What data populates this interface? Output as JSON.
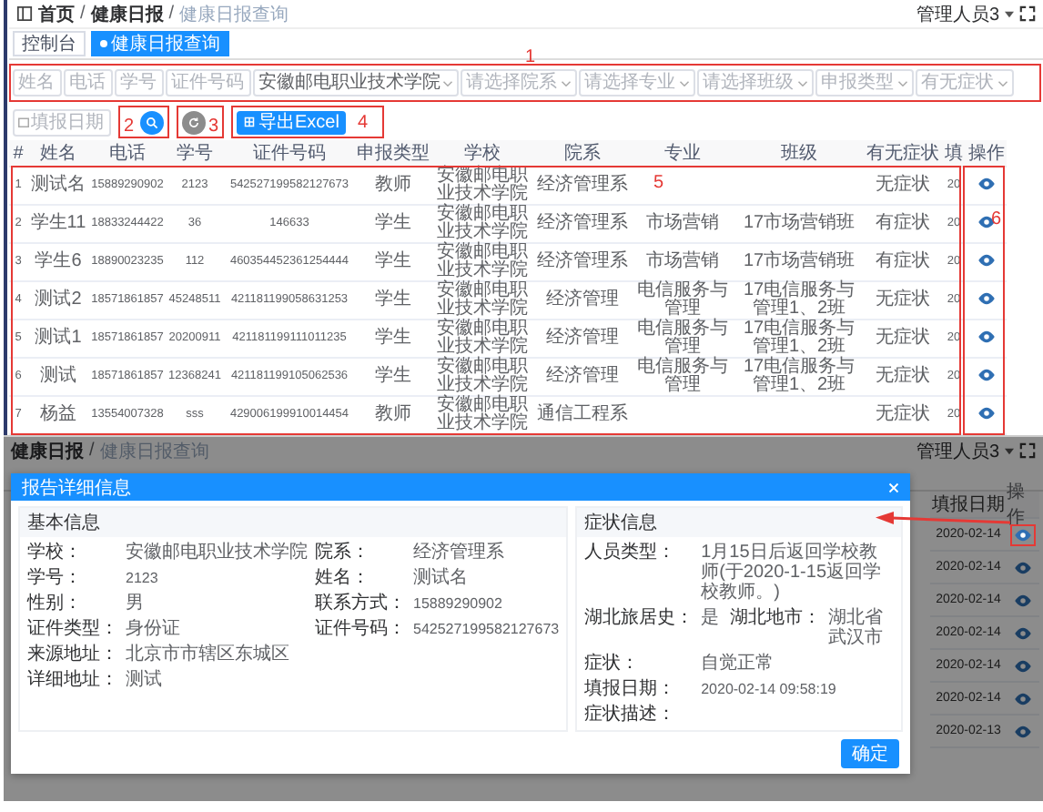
{
  "header": {
    "breadcrumb": [
      "首页",
      "健康日报",
      "健康日报查询"
    ],
    "separator": "/",
    "user": "管理人员3"
  },
  "tags": [
    {
      "label": "控制台",
      "selected": false
    },
    {
      "label": "健康日报查询",
      "selected": true
    }
  ],
  "filters": [
    {
      "kind": "input",
      "placeholder": "姓名"
    },
    {
      "kind": "input",
      "placeholder": "电话"
    },
    {
      "kind": "input",
      "placeholder": "学号"
    },
    {
      "kind": "input",
      "placeholder": "证件号码"
    },
    {
      "kind": "select",
      "value": "安徽邮电职业技术学院"
    },
    {
      "kind": "select",
      "placeholder": "请选择院系"
    },
    {
      "kind": "select",
      "placeholder": "请选择专业"
    },
    {
      "kind": "select",
      "placeholder": "请选择班级"
    },
    {
      "kind": "select",
      "placeholder": "申报类型"
    },
    {
      "kind": "select",
      "placeholder": "有无症状"
    }
  ],
  "date_filter": {
    "placeholder": "填报日期"
  },
  "export_button": "导出Excel",
  "annotations": [
    "1",
    "2",
    "3",
    "4",
    "5",
    "6"
  ],
  "table": {
    "columns": [
      "#",
      "姓名",
      "电话",
      "学号",
      "证件号码",
      "申报类型",
      "学校",
      "院系",
      "专业",
      "班级",
      "有无症状",
      "填",
      "操作"
    ],
    "rows": [
      {
        "index": "1",
        "name": "测试名",
        "phone": "15889290902",
        "student_no": "2123",
        "id_no": "542527199582127673",
        "type": "教师",
        "school": "安徽邮电职业技术学院",
        "department": "经济管理系",
        "symptom": "无症状",
        "date": "20"
      },
      {
        "index": "2",
        "name": "学生11",
        "phone": "18833244422",
        "student_no": "36",
        "id_no": "146633",
        "type": "学生",
        "school": "安徽邮电职业技术学院",
        "department": "经济管理系",
        "major": "市场营销",
        "class": "17市场营销班",
        "symptom": "有症状",
        "date": "20"
      },
      {
        "index": "3",
        "name": "学生6",
        "phone": "18890023235",
        "student_no": "112",
        "id_no": "460354452361254444",
        "type": "学生",
        "school": "安徽邮电职业技术学院",
        "department": "经济管理系",
        "major": "市场营销",
        "class": "17市场营销班",
        "symptom": "有症状",
        "date": "20"
      },
      {
        "index": "4",
        "name": "测试2",
        "phone": "18571861857",
        "student_no": "45248511",
        "id_no": "421181199058631253",
        "type": "学生",
        "school": "安徽邮电职业技术学院",
        "department": "经济管理",
        "major": "电信服务与管理",
        "class": "17电信服务与管理1、2班",
        "symptom": "无症状",
        "date": "20"
      },
      {
        "index": "5",
        "name": "测试1",
        "phone": "18571861857",
        "student_no": "20200911",
        "id_no": "421181199111011235",
        "type": "学生",
        "school": "安徽邮电职业技术学院",
        "department": "经济管理",
        "major": "电信服务与管理",
        "class": "17电信服务与管理1、2班",
        "symptom": "无症状",
        "date": "20"
      },
      {
        "index": "6",
        "name": "测试",
        "phone": "18571861857",
        "student_no": "12368241",
        "id_no": "421181199105062536",
        "type": "学生",
        "school": "安徽邮电职业技术学院",
        "department": "经济管理",
        "major": "电信服务与管理",
        "class": "17电信服务与管理1、2班",
        "symptom": "无症状",
        "date": "20"
      },
      {
        "index": "7",
        "name": "杨益",
        "phone": "13554007328",
        "student_no": "sss",
        "id_no": "429006199910014454",
        "type": "教师",
        "school": "安徽邮电职业技术学院",
        "department": "通信工程系",
        "symptom": "无症状",
        "date": "20"
      }
    ]
  },
  "second_screen": {
    "breadcrumb": [
      "健康日报",
      "健康日报查询"
    ],
    "separator": "/",
    "user": "管理人员3",
    "table": {
      "columns": [
        "填报日期",
        "操作"
      ],
      "rows": [
        {
          "date": "2020-02-14",
          "annotated": true
        },
        {
          "date": "2020-02-14",
          "annotated": false
        },
        {
          "date": "2020-02-14",
          "annotated": false
        },
        {
          "date": "2020-02-14",
          "annotated": false
        },
        {
          "date": "2020-02-14",
          "annotated": false
        },
        {
          "date": "2020-02-14",
          "annotated": false
        },
        {
          "date": "2020-02-13",
          "annotated": false
        }
      ]
    },
    "modal": {
      "title": "报告详细信息",
      "confirm": "确定",
      "cards": [
        {
          "title": "基本信息",
          "rows": [
            [
              {
                "kind": "text",
                "label": "学校：",
                "value": "安徽邮电职业技术学院"
              },
              {
                "kind": "text",
                "label": "院系：",
                "value": "经济管理系"
              }
            ],
            [
              {
                "kind": "number",
                "label": "学号：",
                "value": "2123"
              },
              {
                "kind": "text",
                "label": "姓名：",
                "value": "测试名"
              }
            ],
            [
              {
                "kind": "text",
                "label": "性别：",
                "value": "男"
              },
              {
                "kind": "number",
                "label": "联系方式：",
                "value": "15889290902"
              }
            ],
            [
              {
                "kind": "text",
                "label": "证件类型：",
                "value": "身份证"
              },
              {
                "kind": "number",
                "label": "证件号码：",
                "value": "542527199582127673"
              }
            ],
            [
              {
                "kind": "text",
                "label": "来源地址：",
                "value": "北京市市辖区东城区"
              }
            ],
            [
              {
                "kind": "text",
                "label": "详细地址：",
                "value": "测试"
              }
            ]
          ]
        },
        {
          "title": "症状信息",
          "rows": [
            [
              {
                "kind": "text",
                "label": "人员类型：",
                "value": "1月15日后返回学校教师(于2020-1-15返回学校教师。)"
              }
            ],
            [
              {
                "kind": "text",
                "label": "湖北旅居史：",
                "value": "是"
              },
              {
                "kind": "text",
                "label": "湖北地市：",
                "value": "湖北省武汉市"
              }
            ],
            [
              {
                "kind": "text",
                "label": "症状：",
                "value": "自觉正常"
              }
            ],
            [
              {
                "kind": "number",
                "label": "填报日期：",
                "value": "2020-02-14 09:58:19"
              }
            ],
            [
              {
                "label": "症状描述："
              }
            ]
          ]
        }
      ]
    }
  }
}
